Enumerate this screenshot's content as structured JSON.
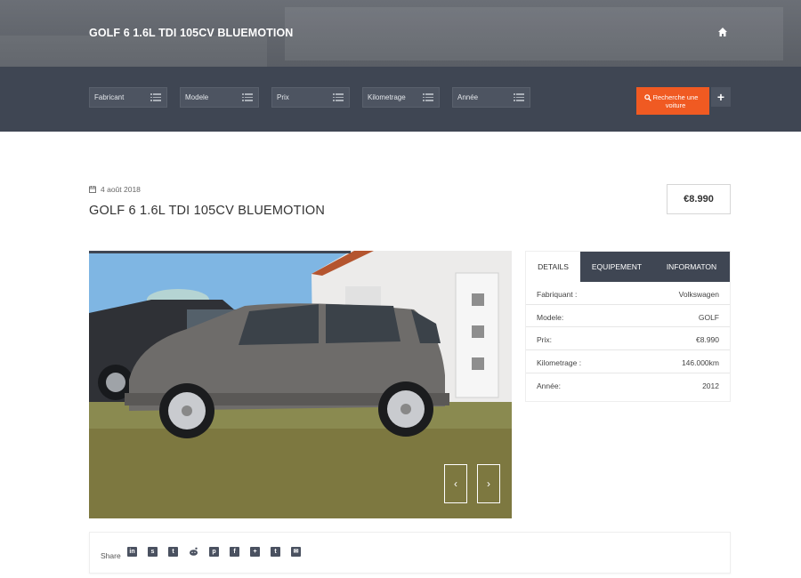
{
  "header": {
    "title": "GOLF 6 1.6L TDI 105CV BLUEMOTION",
    "home_icon": "home-icon"
  },
  "search": {
    "filters": [
      "Fabricant",
      "Modele",
      "Prix",
      "Kilometrage",
      "Année"
    ],
    "button_label": "Recherche une voiture",
    "plus_label": "+",
    "button_color": "#f05a22"
  },
  "listing": {
    "date": "4 août 2018",
    "title": "GOLF 6 1.6L TDI 105CV BLUEMOTION",
    "price": "€8.990"
  },
  "gallery": {
    "prev": "‹",
    "next": "›"
  },
  "details": {
    "tabs": [
      "DETAILS",
      "EQUIPEMENT",
      "INFORMATON"
    ],
    "rows": [
      {
        "k": "Fabriquant :",
        "v": "Volkswagen"
      },
      {
        "k": "Modele:",
        "v": "GOLF"
      },
      {
        "k": "Prix:",
        "v": "€8.990"
      },
      {
        "k": "Kilometrage :",
        "v": "146.000km"
      },
      {
        "k": "Année:",
        "v": "2012"
      }
    ]
  },
  "share": {
    "label": "Share",
    "icons": [
      "linkedin-icon",
      "stumbleupon-icon",
      "tumblr-icon",
      "reddit-icon",
      "pinterest-icon",
      "facebook-icon",
      "googleplus-icon",
      "twitter-icon",
      "email-icon"
    ]
  },
  "colors": {
    "dark_bar": "#3f4653",
    "accent": "#f05a22"
  }
}
